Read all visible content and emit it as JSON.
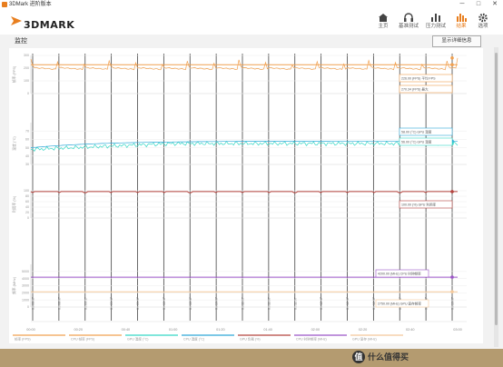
{
  "window": {
    "title": "3DMark 进阶版本",
    "minimize": "─",
    "maximize": "□",
    "close": "✕"
  },
  "header": {
    "logo_text": "3DMARK",
    "nav": [
      {
        "label": "主页",
        "icon": "home-icon"
      },
      {
        "label": "基准测试",
        "icon": "headset-icon"
      },
      {
        "label": "压力测试",
        "icon": "bar-chart-icon"
      },
      {
        "label": "结果",
        "icon": "results-icon",
        "active": true
      },
      {
        "label": "选项",
        "icon": "gear-icon"
      }
    ]
  },
  "page": {
    "title": "监控",
    "detail_button": "显示详细信息"
  },
  "colors": {
    "accent": "#e87e1e",
    "fps": "#f0a050",
    "gpu_temp": "#35d7c5",
    "cpu_temp": "#2ea8d8",
    "cpu_util": "#b5443f",
    "cpu_freq": "#9b55c7",
    "gpu_mem_freq": "#f4c89a"
  },
  "chart_data": {
    "type": "line",
    "panels": [
      {
        "ylabel": "帧率 (FPS)",
        "ylim": [
          0,
          300
        ],
        "yticks": [
          "0",
          "100",
          "200",
          "300"
        ],
        "series": [
          {
            "name": "帧率 (FPS)",
            "color": "#f0a050",
            "pattern": "sawtooth",
            "min": 190,
            "max": 270
          },
          {
            "name": "帧率 (FPS) 平均",
            "color": "#f0a050",
            "constant": 227
          }
        ],
        "annotations": [
          {
            "text": "226.00 (FPS) 平均 FPS",
            "series": 0
          },
          {
            "text": "270.34 (FPS) 最大",
            "series": 1
          }
        ]
      },
      {
        "ylabel": "温度 (°C)",
        "ylim": [
          30,
          80
        ],
        "yticks": [
          "30",
          "40",
          "50",
          "60",
          "70"
        ],
        "series": [
          {
            "name": "GPU 温度 (°C)",
            "color": "#35d7c5",
            "pattern": "noisy",
            "start": 48,
            "end": 55
          },
          {
            "name": "CPU 温度 (°C)",
            "color": "#2ea8d8",
            "pattern": "rise",
            "start": 50,
            "end": 58
          }
        ],
        "annotations": [
          {
            "text": "58.00 (°C) GPU 温度",
            "series": 1
          },
          {
            "text": "56.00 (°C) GPU 温度",
            "series": 0
          }
        ]
      },
      {
        "ylabel": "利用率 (%)",
        "ylim": [
          0,
          100
        ],
        "yticks": [
          "0",
          "20",
          "40",
          "60",
          "80",
          "100"
        ],
        "series": [
          {
            "name": "CPU 利用率 (%)",
            "color": "#b5443f",
            "constant": 97
          }
        ],
        "annotations": [
          {
            "text": "100.00 (%) GPU 利用率",
            "series": 0
          }
        ]
      },
      {
        "ylabel": "频率 (MHz)",
        "ylim": [
          0,
          6000
        ],
        "yticks": [
          "0",
          "1000",
          "2000",
          "3000",
          "4000",
          "5000"
        ],
        "series": [
          {
            "name": "CPU 时钟频率 (MHz)",
            "color": "#9b55c7",
            "constant": 4200
          },
          {
            "name": "GPU 显存时钟频率 (MHz)",
            "color": "#f4c89a",
            "constant": 2150
          }
        ],
        "annotations": [
          {
            "text": "4200.00 (MHz) CPU 时钟频率",
            "series": 0
          },
          {
            "text": "2750.00 (MHz) GPU 显存频率",
            "series": 1
          }
        ]
      }
    ],
    "x": {
      "ticks": [
        "00:00",
        "00:20",
        "00:40",
        "01:00",
        "01:20",
        "01:40",
        "02:00",
        "02:20",
        "02:40",
        "03:00"
      ],
      "markers": [
        "01:08:37",
        "01:08:57",
        "01:09:17",
        "01:09:37",
        "01:09:57",
        "01:10:17",
        "01:10:37",
        "01:10:57",
        "01:11:17",
        "01:11:37",
        "01:11:57",
        "01:12:17",
        "01:12:37",
        "01:12:57",
        "01:13:17",
        "01:13:37",
        "01:13:57"
      ]
    },
    "legend": [
      {
        "name": "帧率 (FPS)",
        "color": "#f0a050"
      },
      {
        "name": "CPU 帧率 (FPS)",
        "color": "#f0a050"
      },
      {
        "name": "GPU 温度 (°C)",
        "color": "#35d7c5"
      },
      {
        "name": "CPU 温度 (°C)",
        "color": "#2ea8d8"
      },
      {
        "name": "GPU 负载 (%)",
        "color": "#b5443f"
      },
      {
        "name": "CPU 时钟频率 (MHz)",
        "color": "#9b55c7"
      },
      {
        "name": "GPU 显存 (MHz)",
        "color": "#f4c89a"
      }
    ]
  },
  "watermark": {
    "badge": "值",
    "text": "什么值得买"
  }
}
